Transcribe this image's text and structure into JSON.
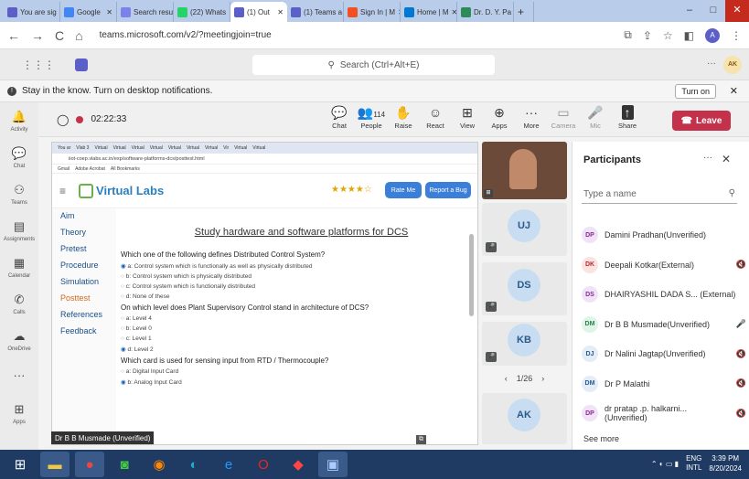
{
  "browser": {
    "tabs": [
      {
        "label": "You are sig",
        "color": "#5b5fc7"
      },
      {
        "label": "Google",
        "color": "#4285f4"
      },
      {
        "label": "Search resu",
        "color": "#7b83eb"
      },
      {
        "label": "(22) Whats",
        "color": "#25d366"
      },
      {
        "label": "(1) Out",
        "color": "#5b5fc7",
        "active": true
      },
      {
        "label": "(1) Teams a",
        "color": "#5b5fc7"
      },
      {
        "label": "Sign In | M",
        "color": "#f25022"
      },
      {
        "label": "Home | M",
        "color": "#0078d4"
      },
      {
        "label": "Dr. D. Y. Pa",
        "color": "#2e8b57"
      }
    ],
    "new_tab": "+",
    "url": "teams.microsoft.com/v2/?meetingjoin=true",
    "profile": "A"
  },
  "teams": {
    "search_placeholder": "Search (Ctrl+Alt+E)",
    "user_initials": "AK",
    "notification": "Stay in the know. Turn on desktop notifications.",
    "turn_on": "Turn on"
  },
  "rail": [
    {
      "label": "Activity",
      "icon": "bell"
    },
    {
      "label": "Chat",
      "icon": "chat"
    },
    {
      "label": "Teams",
      "icon": "teams"
    },
    {
      "label": "Assignments",
      "icon": "assign"
    },
    {
      "label": "Calendar",
      "icon": "calendar"
    },
    {
      "label": "Calls",
      "icon": "phone"
    },
    {
      "label": "OneDrive",
      "icon": "cloud"
    },
    {
      "label": "",
      "icon": "more"
    },
    {
      "label": "Apps",
      "icon": "plus"
    }
  ],
  "meeting": {
    "timer": "02:22:33",
    "tools": [
      {
        "label": "Chat",
        "ic": "💬"
      },
      {
        "label": "People",
        "ic": "👥",
        "badge": "114"
      },
      {
        "label": "Raise",
        "ic": "✋"
      },
      {
        "label": "React",
        "ic": "☺"
      },
      {
        "label": "View",
        "ic": "⊞"
      },
      {
        "label": "Apps",
        "ic": "⊕"
      },
      {
        "label": "More",
        "ic": "···"
      },
      {
        "label": "Camera",
        "ic": "▭"
      },
      {
        "label": "Mic",
        "ic": "🎤"
      },
      {
        "label": "Share",
        "ic": "↑"
      }
    ],
    "leave": "Leave"
  },
  "shared": {
    "inner_tabs": [
      "You ar",
      "Vlab 3",
      "Virtual",
      "Virtual",
      "Virtual",
      "Virtual",
      "Virtual",
      "Virtual",
      "Virtual",
      "Vir",
      "Virtual",
      "Virtual"
    ],
    "inner_url": "iiot-coep.vlabs.ac.in/exp/software-platforms-dcs/posttest.html",
    "bookmarks": [
      "Gmail",
      "Adobe Acrobat",
      "All Bookmarks"
    ],
    "logo": "Virtual Labs",
    "rate": "Rate Me",
    "report": "Report a Bug",
    "stars": "★★★★☆",
    "nav": [
      "Aim",
      "Theory",
      "Pretest",
      "Procedure",
      "Simulation",
      "Posttest",
      "References",
      "Feedback"
    ],
    "active_nav": "Posttest",
    "title": "Study hardware and software platforms for DCS",
    "questions": [
      {
        "q": "Which one of the following defines Distributed Control System?",
        "opts": [
          "a: Control system which is functionally as well as physically distributed",
          "b: Control system which is physically distributed",
          "c: Control system which is functionally distributed",
          "d: None of these"
        ],
        "sel": 0
      },
      {
        "q": "On which level does Plant Supervisory Control stand in architecture of DCS?",
        "opts": [
          "a: Level 4",
          "b: Level 0",
          "c: Level 1",
          "d: Level 2"
        ],
        "sel": 3
      },
      {
        "q": "Which card is used for sensing input from RTD / Thermocouple?",
        "opts": [
          "a: Digital Input Card",
          "b: Analog Input Card"
        ],
        "sel": 1
      }
    ],
    "presenter": "Dr B B Musmade (Unverified)"
  },
  "tiles": [
    {
      "initials": "UJ"
    },
    {
      "initials": "DS"
    },
    {
      "initials": "KB"
    },
    {
      "initials": "AK"
    }
  ],
  "pager": "1/26",
  "participants": {
    "title": "Participants",
    "search": "Type a name",
    "list": [
      {
        "initials": "DP",
        "name": "Damini Pradhan(Unverified)",
        "bg": "#f1e3f7",
        "fg": "#8a2b8f",
        "icon": ""
      },
      {
        "initials": "DK",
        "name": "Deepali Kotkar(External)",
        "bg": "#fde2e2",
        "fg": "#b42b2b",
        "icon": "🔇"
      },
      {
        "initials": "DS",
        "name": "DHAIRYASHIL DADA S... (External)",
        "bg": "#f1e3f7",
        "fg": "#8a2b8f",
        "icon": ""
      },
      {
        "initials": "DM",
        "name": "Dr B B Musmade(Unverified)",
        "bg": "#dff5e8",
        "fg": "#2f7d4f",
        "icon": "🎤"
      },
      {
        "initials": "DJ",
        "name": "Dr Nalini Jagtap(Unverified)",
        "bg": "#e4ecf7",
        "fg": "#2a5a8b",
        "icon": "🔇"
      },
      {
        "initials": "DM",
        "name": "Dr P Malathi",
        "bg": "#e4ecf7",
        "fg": "#2a5a8b",
        "icon": "🔇"
      },
      {
        "initials": "DP",
        "name": "dr pratap .p. halkarni... (Unverified)",
        "bg": "#f1e3f7",
        "fg": "#8a2b8f",
        "icon": "🔇"
      }
    ],
    "see_more": "See more"
  },
  "taskbar": {
    "lang": "ENG",
    "region": "INTL",
    "time": "3:39 PM",
    "date": "8/20/2024"
  }
}
